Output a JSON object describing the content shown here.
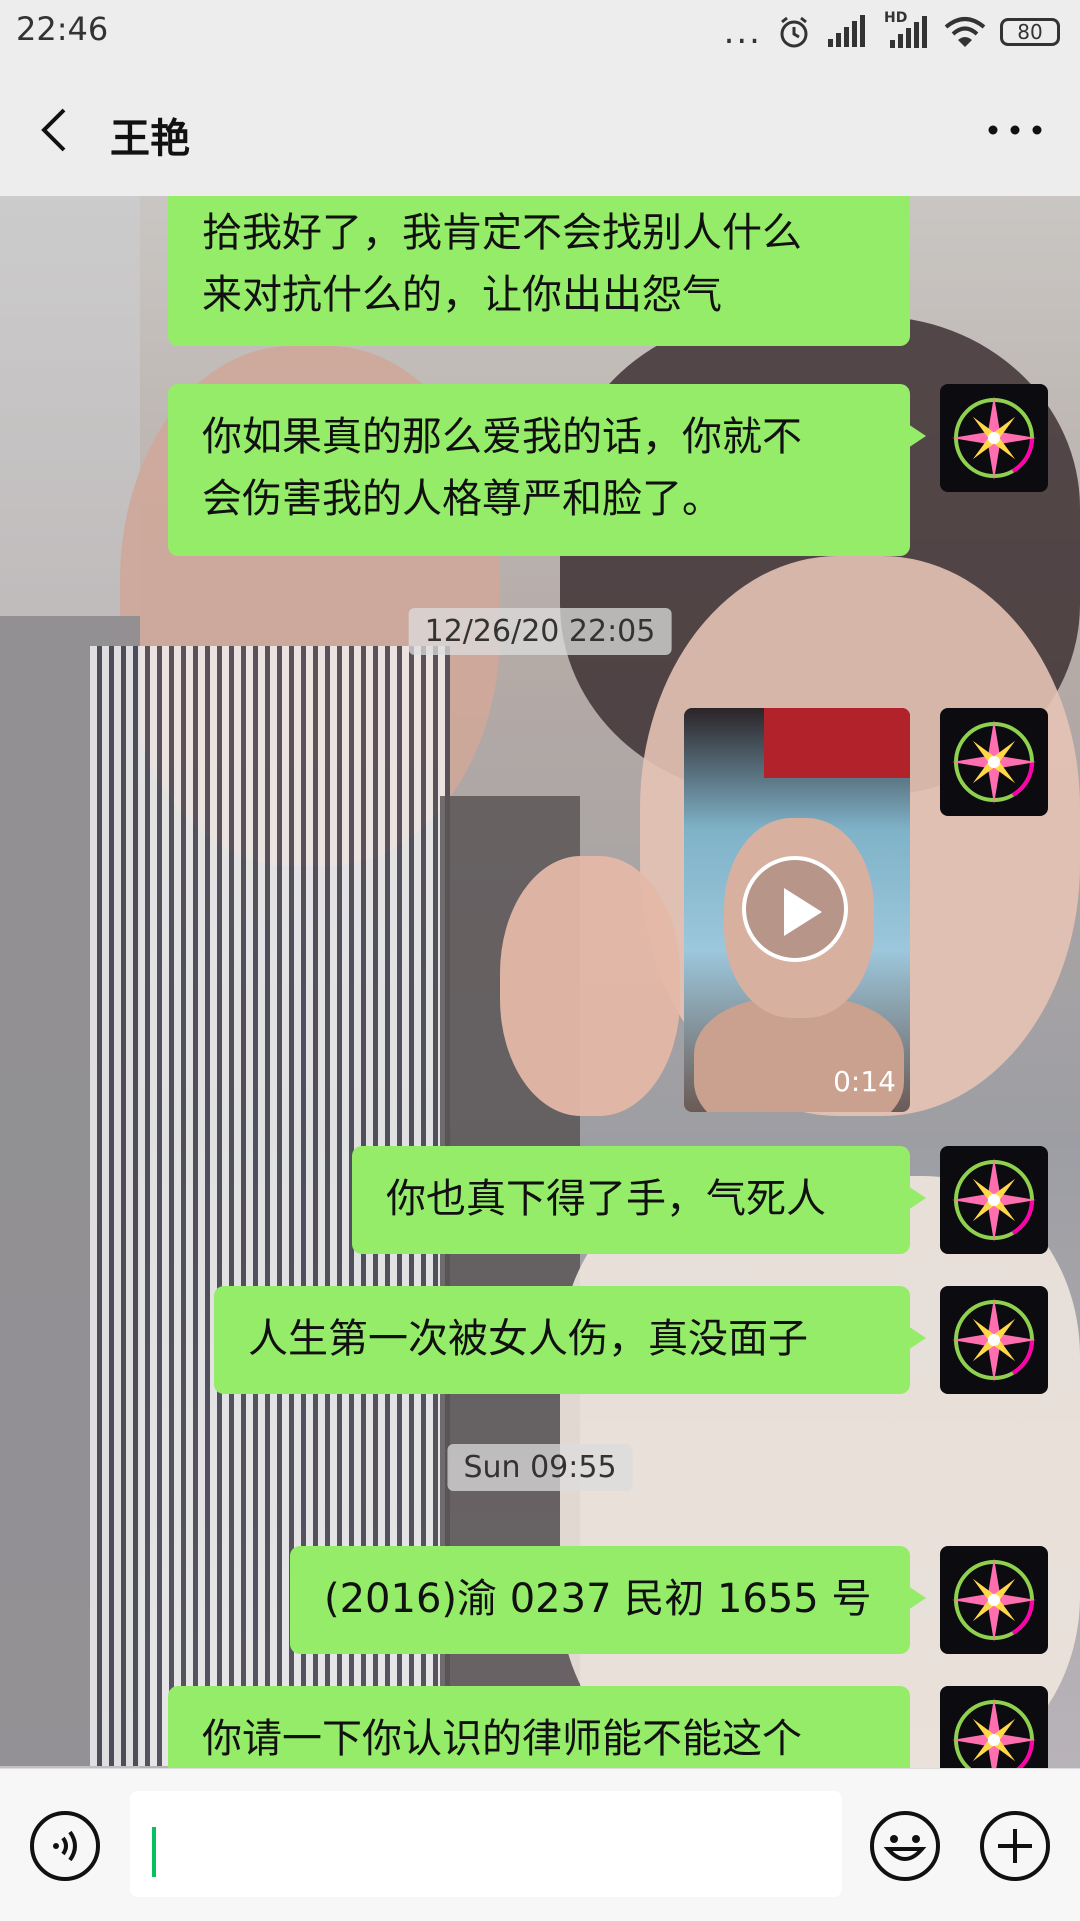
{
  "status_bar": {
    "time": "22:46",
    "more_dots": "...",
    "network_label": "HD",
    "battery": "80"
  },
  "header": {
    "contact_name": "王艳"
  },
  "messages": [
    {
      "type": "text",
      "line1": "拾我好了，我肯定不会找别人什么",
      "line2": "来对抗什么的，让你出出怨气"
    },
    {
      "type": "text",
      "line1": "你如果真的那么爱我的话，你就不",
      "line2": "会伤害我的人格尊严和脸了。"
    },
    {
      "type": "timestamp",
      "text": "12/26/20 22:05"
    },
    {
      "type": "video",
      "duration": "0:14"
    },
    {
      "type": "text",
      "text": "你也真下得了手，气死人"
    },
    {
      "type": "text",
      "text": "人生第一次被女人伤，真没面子"
    },
    {
      "type": "timestamp",
      "text": "Sun 09:55"
    },
    {
      "type": "text",
      "text": "(2016)渝 0237 民初 1655 号"
    },
    {
      "type": "text",
      "text": "你请一下你认识的律师能不能这个"
    }
  ],
  "input": {
    "value": "",
    "placeholder": ""
  },
  "colors": {
    "bubble_green": "#95ec69",
    "bar_background": "#ededed",
    "input_bar_background": "#f7f7f7",
    "caret": "#07c160"
  },
  "icons": {
    "back": "chevron-left-icon",
    "more": "more-horizontal-icon",
    "voice": "voice-input-icon",
    "emoji": "emoji-icon",
    "plus": "plus-circle-icon",
    "play": "play-icon",
    "avatar": "compass-star-avatar"
  }
}
